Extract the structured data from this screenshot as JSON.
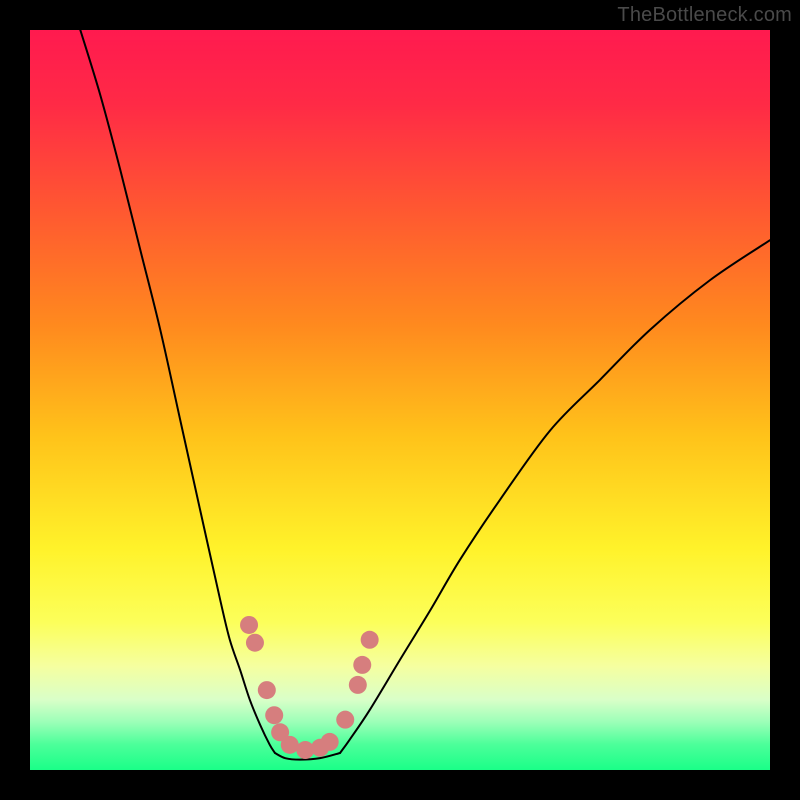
{
  "attribution": "TheBottleneck.com",
  "gradient": {
    "stops": [
      {
        "offset": 0.0,
        "color": "#ff1a4f"
      },
      {
        "offset": 0.1,
        "color": "#ff2a46"
      },
      {
        "offset": 0.25,
        "color": "#ff5a30"
      },
      {
        "offset": 0.4,
        "color": "#ff8a1e"
      },
      {
        "offset": 0.55,
        "color": "#ffc31a"
      },
      {
        "offset": 0.7,
        "color": "#fff22a"
      },
      {
        "offset": 0.8,
        "color": "#fcff5a"
      },
      {
        "offset": 0.86,
        "color": "#f5ffa0"
      },
      {
        "offset": 0.905,
        "color": "#d9ffc8"
      },
      {
        "offset": 0.935,
        "color": "#9cffb8"
      },
      {
        "offset": 0.965,
        "color": "#4dff9a"
      },
      {
        "offset": 1.0,
        "color": "#1aff88"
      }
    ]
  },
  "chart_data": {
    "type": "line",
    "title": "",
    "xlabel": "",
    "ylabel": "",
    "xlim": [
      0,
      100
    ],
    "ylim": [
      0,
      100
    ],
    "series": [
      {
        "name": "curve-left",
        "x": [
          6.8,
          9.5,
          12.2,
          14.9,
          17.6,
          20.3,
          23.0,
          25.7,
          27.0,
          28.4,
          29.7,
          31.1,
          32.4,
          33.1
        ],
        "y": [
          100.0,
          91.2,
          81.1,
          70.3,
          59.5,
          47.3,
          35.1,
          23.0,
          17.6,
          13.5,
          9.5,
          6.1,
          3.4,
          2.3
        ]
      },
      {
        "name": "curve-right",
        "x": [
          41.9,
          43.2,
          45.9,
          50.0,
          54.1,
          58.1,
          63.5,
          70.3,
          77.0,
          83.8,
          91.9,
          100.0
        ],
        "y": [
          2.3,
          4.1,
          8.1,
          14.9,
          21.6,
          28.4,
          36.5,
          45.9,
          52.7,
          59.5,
          66.2,
          71.6
        ]
      },
      {
        "name": "valley-floor",
        "x": [
          33.1,
          34.5,
          36.5,
          39.2,
          41.9
        ],
        "y": [
          2.3,
          1.6,
          1.4,
          1.6,
          2.3
        ]
      }
    ],
    "markers": {
      "name": "data-points",
      "color": "#d67e7e",
      "radius": 9,
      "points": [
        {
          "x": 29.6,
          "y": 19.6
        },
        {
          "x": 30.4,
          "y": 17.2
        },
        {
          "x": 32.0,
          "y": 10.8
        },
        {
          "x": 33.0,
          "y": 7.4
        },
        {
          "x": 33.8,
          "y": 5.1
        },
        {
          "x": 35.1,
          "y": 3.4
        },
        {
          "x": 37.2,
          "y": 2.7
        },
        {
          "x": 39.2,
          "y": 3.0
        },
        {
          "x": 40.5,
          "y": 3.8
        },
        {
          "x": 42.6,
          "y": 6.8
        },
        {
          "x": 44.3,
          "y": 11.5
        },
        {
          "x": 44.9,
          "y": 14.2
        },
        {
          "x": 45.9,
          "y": 17.6
        }
      ]
    }
  }
}
